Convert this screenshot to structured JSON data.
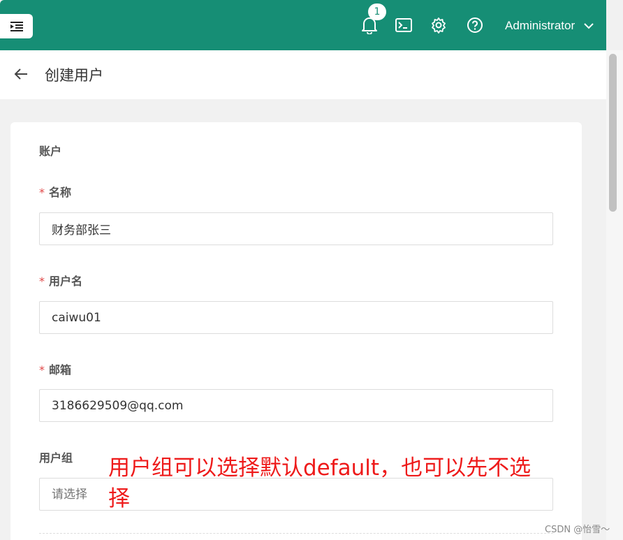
{
  "topbar": {
    "notification_count": "1",
    "user_name": "Administrator"
  },
  "header": {
    "title": "创建用户"
  },
  "form": {
    "section_title": "账户",
    "required_mark": "*",
    "fields": {
      "name": {
        "label": "名称",
        "value": "财务部张三"
      },
      "username": {
        "label": "用户名",
        "value": "caiwu01"
      },
      "email": {
        "label": "邮箱",
        "value": "3186629509@qq.com"
      },
      "group": {
        "label": "用户组",
        "placeholder": "请选择"
      }
    }
  },
  "annotation": {
    "text": "用户组可以选择默认default，也可以先不选择"
  },
  "watermark": "CSDN @怡雪～",
  "colors": {
    "topbar": "#168e75",
    "required": "#e04848",
    "annotation": "#ee1a1a"
  },
  "icons": [
    "menu-toggle-icon",
    "bell-icon",
    "terminal-icon",
    "gear-icon",
    "help-icon",
    "chevron-down-icon",
    "back-arrow-icon"
  ]
}
